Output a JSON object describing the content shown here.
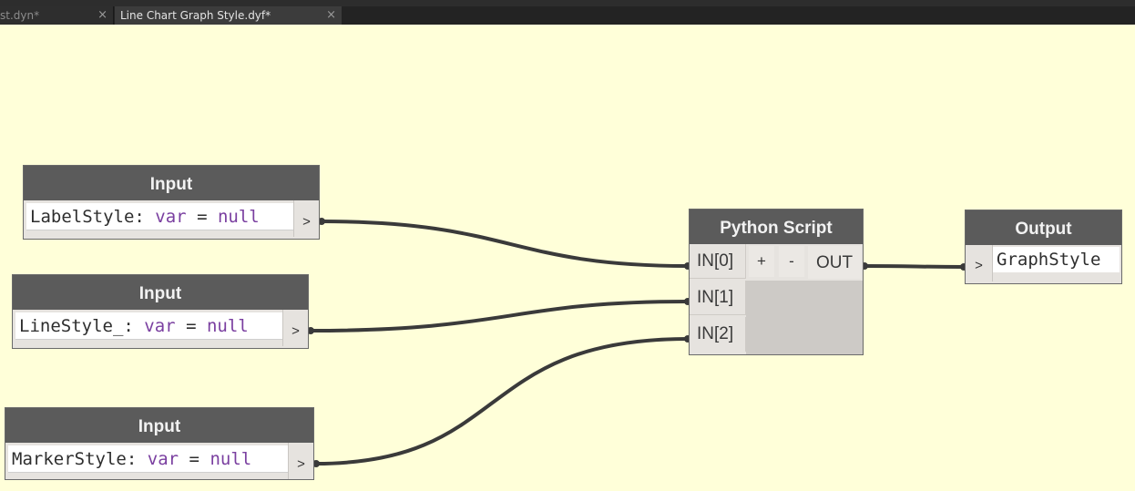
{
  "tabs": [
    {
      "label": "st.dyn*",
      "close": "×"
    },
    {
      "label": "Line Chart Graph Style.dyf*",
      "close": "×"
    }
  ],
  "input_nodes": [
    {
      "title": "Input",
      "name": "LabelStyle",
      "colon": ":",
      "kw_type": "var",
      "eq": "=",
      "kw_value": "null",
      "port": ">"
    },
    {
      "title": "Input",
      "name": "LineStyle_",
      "colon": ":",
      "kw_type": "var",
      "eq": "=",
      "kw_value": "null",
      "port": ">"
    },
    {
      "title": "Input",
      "name": "MarkerStyle",
      "colon": ":",
      "kw_type": "var",
      "eq": "=",
      "kw_value": "null",
      "port": ">"
    }
  ],
  "python_node": {
    "title": "Python Script",
    "inputs": [
      "IN[0]",
      "IN[1]",
      "IN[2]"
    ],
    "add_label": "+",
    "remove_label": "-",
    "output": "OUT"
  },
  "output_node": {
    "title": "Output",
    "port": ">",
    "name": "GraphStyle"
  },
  "colors": {
    "canvas": "#ffffd9",
    "node_header": "#5b5b5b",
    "keyword": "#7a3fa0",
    "wire": "#3a3a3a"
  }
}
